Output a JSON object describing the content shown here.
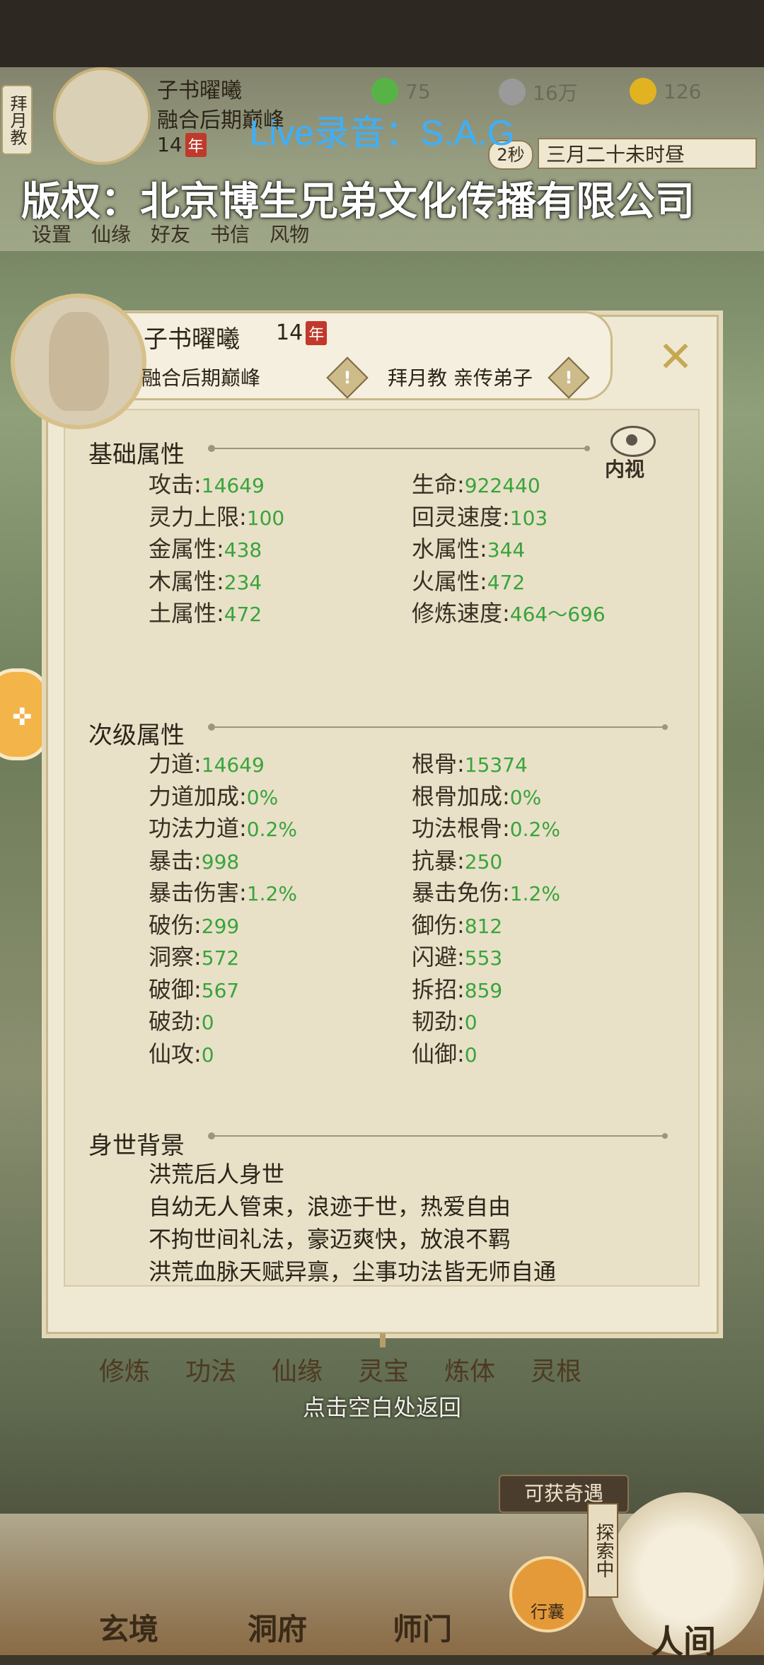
{
  "hud": {
    "sect": "拜月教",
    "name": "子书曜曦",
    "realm": "融合后期巅峰",
    "age": "14",
    "nian": "年",
    "res1": "75",
    "res2": "16万",
    "res3": "126",
    "timer": "2秒",
    "time": "三月二十未时昼",
    "menu": [
      "设置",
      "仙缘",
      "好友",
      "书信",
      "风物"
    ]
  },
  "watermark": {
    "line1": "Live录音：S.A.G",
    "line2": "版权：北京博生兄弟文化传播有限公司"
  },
  "panel": {
    "name": "子书曜曦",
    "age": "14",
    "nian": "年",
    "realm": "融合后期巅峰",
    "sect": "拜月教 亲传弟子",
    "warn": "!",
    "close": "✕",
    "eye_label": "内视"
  },
  "basic": {
    "title": "基础属性",
    "stats": [
      {
        "label": "攻击",
        "value": "14649"
      },
      {
        "label": "生命",
        "value": "922440"
      },
      {
        "label": "灵力上限",
        "value": "100"
      },
      {
        "label": "回灵速度",
        "value": "103"
      },
      {
        "label": "金属性",
        "value": "438"
      },
      {
        "label": "水属性",
        "value": "344"
      },
      {
        "label": "木属性",
        "value": "234"
      },
      {
        "label": "火属性",
        "value": "472"
      },
      {
        "label": "土属性",
        "value": "472"
      },
      {
        "label": "修炼速度",
        "value": "464～696"
      }
    ]
  },
  "secondary": {
    "title": "次级属性",
    "stats": [
      {
        "label": "力道",
        "value": "14649"
      },
      {
        "label": "根骨",
        "value": "15374"
      },
      {
        "label": "力道加成",
        "value": "0%"
      },
      {
        "label": "根骨加成",
        "value": "0%"
      },
      {
        "label": "功法力道",
        "value": "0.2%"
      },
      {
        "label": "功法根骨",
        "value": "0.2%"
      },
      {
        "label": "暴击",
        "value": "998"
      },
      {
        "label": "抗暴",
        "value": "250"
      },
      {
        "label": "暴击伤害",
        "value": "1.2%"
      },
      {
        "label": "暴击免伤",
        "value": "1.2%"
      },
      {
        "label": "破伤",
        "value": "299"
      },
      {
        "label": "御伤",
        "value": "812"
      },
      {
        "label": "洞察",
        "value": "572"
      },
      {
        "label": "闪避",
        "value": "553"
      },
      {
        "label": "破御",
        "value": "567"
      },
      {
        "label": "拆招",
        "value": "859"
      },
      {
        "label": "破劲",
        "value": "0"
      },
      {
        "label": "韧劲",
        "value": "0"
      },
      {
        "label": "仙攻",
        "value": "0"
      },
      {
        "label": "仙御",
        "value": "0"
      }
    ]
  },
  "background": {
    "title": "身世背景",
    "lines": [
      "洪荒后人身世",
      "自幼无人管束，浪迹于世，热爱自由",
      "不拘世间礼法，豪迈爽快，放浪不羁",
      "洪荒血脉天赋异禀，尘事功法皆无师自通"
    ]
  },
  "under": {
    "buttons": [
      "修炼",
      "功法",
      "仙缘",
      "灵宝",
      "炼体",
      "灵根"
    ],
    "return_hint": "点击空白处返回",
    "qiyu": "可获奇遇"
  },
  "nav": {
    "items": [
      "玄境",
      "洞府",
      "师门"
    ],
    "bag": "行囊",
    "explore": "探索中",
    "renjian": "人间"
  },
  "colors": {
    "value_green": "#3aa33a",
    "accent_gold": "#c7a852"
  }
}
